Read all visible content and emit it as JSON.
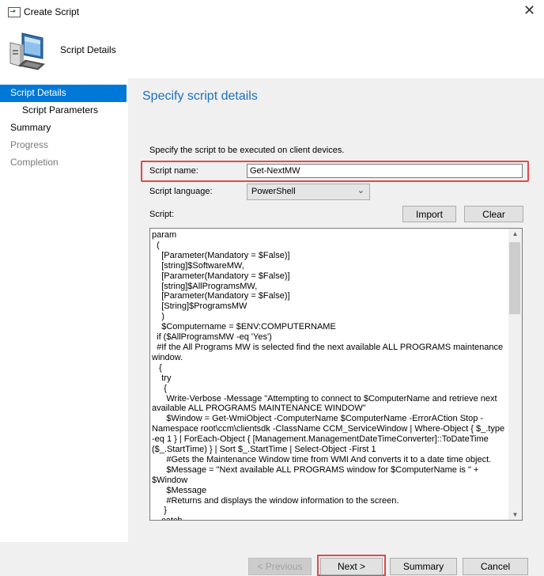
{
  "window": {
    "title": "Create Script",
    "close_glyph": "✕"
  },
  "header": {
    "title": "Script Details",
    "icon": "computer-icon"
  },
  "sidebar": {
    "items": [
      {
        "label": "Script Details",
        "state": "active"
      },
      {
        "label": "Script Parameters",
        "state": "sub"
      },
      {
        "label": "Summary",
        "state": "normal"
      },
      {
        "label": "Progress",
        "state": "disabled"
      },
      {
        "label": "Completion",
        "state": "disabled"
      }
    ]
  },
  "content": {
    "title": "Specify script details",
    "description": "Specify the script to be executed on client devices.",
    "script_name_label": "Script name:",
    "script_name_value": "Get-NextMW",
    "script_language_label": "Script language:",
    "script_language_value": "PowerShell",
    "script_label": "Script:",
    "import_label": "Import",
    "clear_label": "Clear",
    "script_lines": [
      "param",
      "  (",
      "    [Parameter(Mandatory = $False)]",
      "    [string]$SoftwareMW,",
      "    [Parameter(Mandatory = $False)]",
      "    [string]$AllProgramsMW,",
      "    [Parameter(Mandatory = $False)]",
      "    [String]$ProgramsMW",
      "    )",
      "    $Computername = $ENV:COMPUTERNAME",
      "  if ($AllProgramsMW -eq 'Yes')",
      "  #If the All Programs MW is selected find the next available ALL PROGRAMS maintenance window.",
      "   {",
      "    try",
      "     {",
      "      Write-Verbose -Message \"Attempting to connect to $ComputerName and retrieve next available ALL PROGRAMS MAINTENANCE WINDOW\"",
      "      $Window = Get-WmiObject -ComputerName $ComputerName -ErrorACtion Stop -Namespace root\\ccm\\clientsdk -ClassName CCM_ServiceWindow | Where-Object { $_.type -eq 1 } | ForEach-Object { [Management.ManagementDateTimeConverter]::ToDateTime ($_.StartTime) } | Sort $_.StartTime | Select-Object -First 1",
      "      #Gets the Maintenance Window time from WMI And converts it to a date time object.",
      "      $Message = \"Next available ALL PROGRAMS window for $ComputerName is \" + $Window",
      "      $Message",
      "      #Returns and displays the window information to the screen.",
      "     }",
      "    catch"
    ]
  },
  "footer": {
    "previous_label": "< Previous",
    "next_label": "Next >",
    "summary_label": "Summary",
    "cancel_label": "Cancel"
  }
}
